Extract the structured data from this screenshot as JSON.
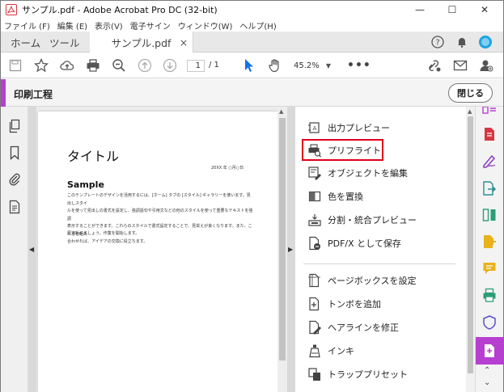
{
  "window": {
    "title": "サンプル.pdf - Adobe Acrobat Pro DC (32-bit)",
    "controls": [
      "—",
      "☐",
      "✕"
    ]
  },
  "menubar": [
    "ファイル (F)",
    "編集 (E)",
    "表示(V)",
    "電子サイン",
    "ウィンドウ(W)",
    "ヘルプ(H)"
  ],
  "tabs": {
    "home": "ホーム",
    "tools": "ツール",
    "document": "サンプル.pdf",
    "close": "×"
  },
  "toolbar": {
    "page_current": "1",
    "page_total": "/ 1",
    "zoom": "45.2%",
    "more": "•••"
  },
  "tool_header": {
    "title": "印刷工程",
    "close_label": "閉じる"
  },
  "document": {
    "title": "タイトル",
    "date": "20XX 年 ○月○日",
    "heading": "Sample",
    "body_lines": [
      "このテンプレートのデザインを活用するには、[ホーム] タブの [スタイル] ギャラリーを使います。見出しスタイ",
      "ルを使って見出しの書式を設定し、強調語句や引用文などの他のスタイルを使って重要なテキストを強調",
      "表示することができます。これらのスタイルで書式設定することで、見栄えが良くなります。また、これらを組み",
      "合わせれば、アイデアの交換に役立ちます。"
    ],
    "closing": "早速始めましょう。作業を開始します。"
  },
  "tools_panel": {
    "items": [
      {
        "label": "出力プレビュー",
        "icon": "output-preview-icon"
      },
      {
        "label": "プリフライト",
        "icon": "preflight-icon"
      },
      {
        "label": "オブジェクトを編集",
        "icon": "edit-object-icon"
      },
      {
        "label": "色を置換",
        "icon": "replace-color-icon"
      },
      {
        "label": "分割・統合プレビュー",
        "icon": "flattener-preview-icon"
      },
      {
        "label": "PDF/X として保存",
        "icon": "save-pdfx-icon"
      },
      {
        "label": "ページボックスを設定",
        "icon": "page-box-icon"
      },
      {
        "label": "トンボを追加",
        "icon": "printer-marks-icon"
      },
      {
        "label": "ヘアラインを修正",
        "icon": "fix-hairlines-icon"
      },
      {
        "label": "インキ",
        "icon": "ink-icon"
      },
      {
        "label": "トラッププリセット",
        "icon": "trap-preset-icon"
      }
    ]
  },
  "colors": {
    "accent": "#b73fd0",
    "highlight": "#e0001b",
    "pdf_red": "#d7373f"
  }
}
